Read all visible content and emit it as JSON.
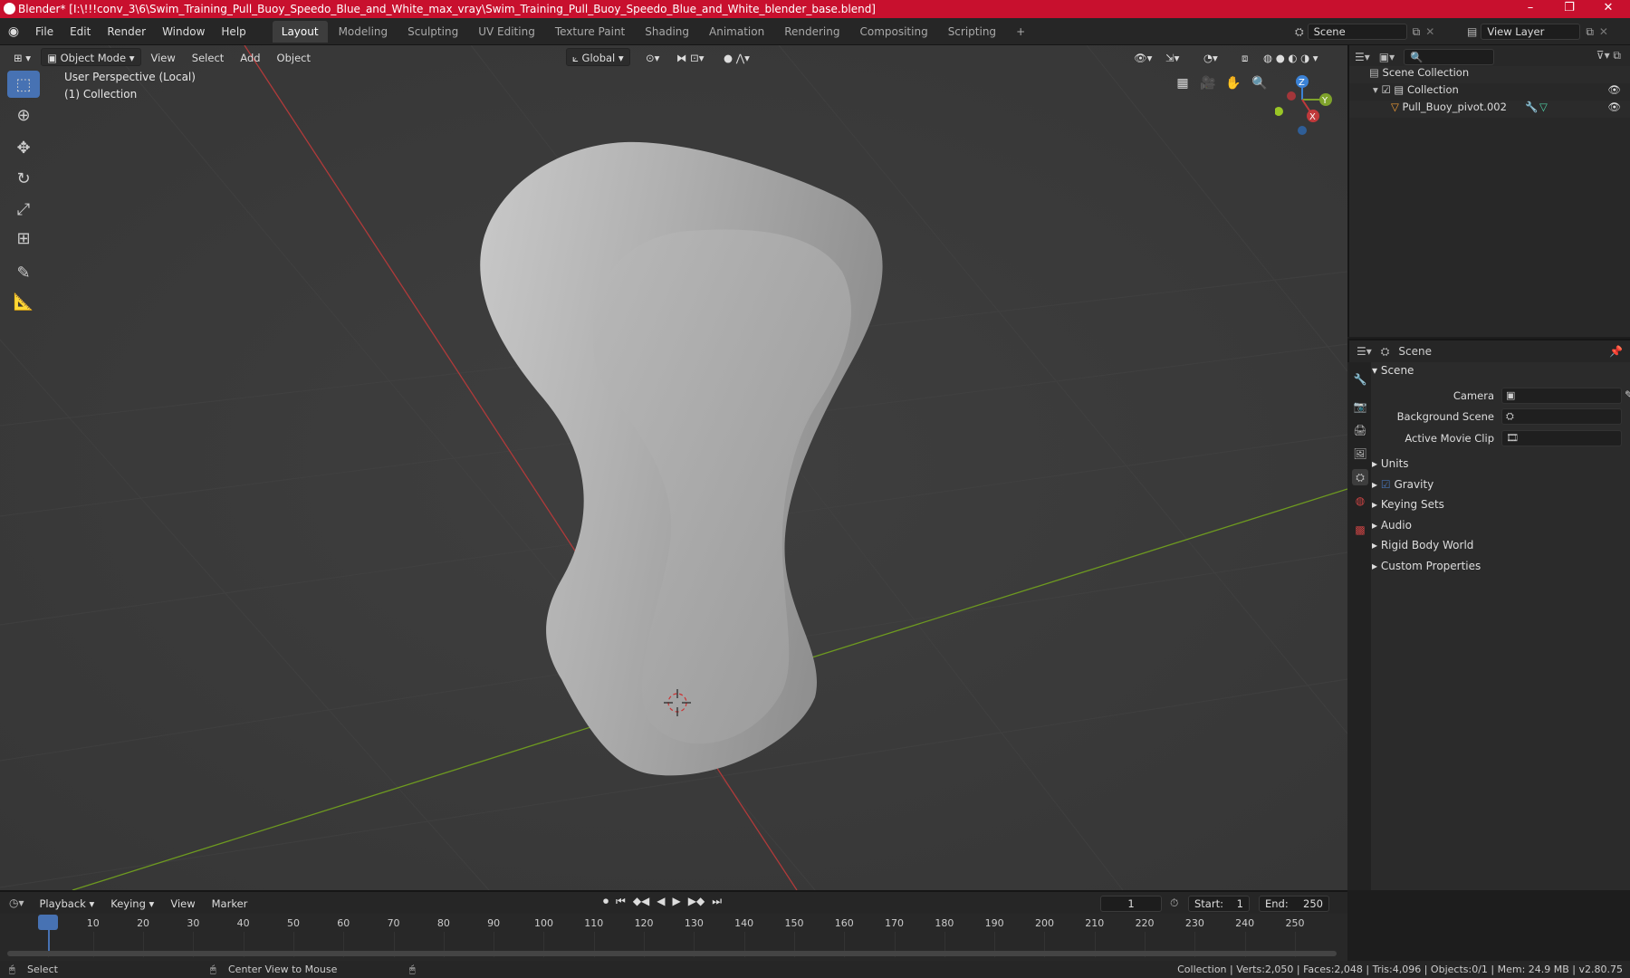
{
  "window": {
    "title": "Blender* [I:\\!!!conv_3\\6\\Swim_Training_Pull_Buoy_Speedo_Blue_and_White_max_vray\\Swim_Training_Pull_Buoy_Speedo_Blue_and_White_blender_base.blend]",
    "minimize": "–",
    "maximize": "❐",
    "close": "✕"
  },
  "menu": [
    "File",
    "Edit",
    "Render",
    "Window",
    "Help"
  ],
  "workspaces": [
    "Layout",
    "Modeling",
    "Sculpting",
    "UV Editing",
    "Texture Paint",
    "Shading",
    "Animation",
    "Rendering",
    "Compositing",
    "Scripting"
  ],
  "add_workspace": "+",
  "scene_field": "Scene",
  "view_layer_field": "View Layer",
  "viewport": {
    "mode": "Object Mode",
    "menus": [
      "View",
      "Select",
      "Add",
      "Object"
    ],
    "orientation": "Global",
    "overlay_text_1": "User Perspective (Local)",
    "overlay_text_2": "(1) Collection",
    "gizmo": {
      "x": "X",
      "y": "Y",
      "z": "Z"
    }
  },
  "outliner": {
    "search_placeholder": "",
    "rows": [
      "Scene Collection",
      "Collection",
      "Pull_Buoy_pivot.002"
    ]
  },
  "properties": {
    "header": "Scene",
    "section": "Scene",
    "fields": [
      "Camera",
      "Background Scene",
      "Active Movie Clip"
    ],
    "subsections": [
      "Units",
      "Gravity",
      "Keying Sets",
      "Audio",
      "Rigid Body World",
      "Custom Properties"
    ]
  },
  "timeline": {
    "menus": [
      "Playback",
      "Keying",
      "View",
      "Marker"
    ],
    "current_frame": "1",
    "start_label": "Start:",
    "start": "1",
    "end_label": "End:",
    "end": "250",
    "ticks": [
      "1",
      "10",
      "20",
      "30",
      "40",
      "50",
      "60",
      "70",
      "80",
      "90",
      "100",
      "110",
      "120",
      "130",
      "140",
      "150",
      "160",
      "170",
      "180",
      "190",
      "200",
      "210",
      "220",
      "230",
      "240",
      "250"
    ]
  },
  "status": {
    "left": "Select",
    "middle": "Center View to Mouse",
    "right": "Collection | Verts:2,050 | Faces:2,048 | Tris:4,096 | Objects:0/1 | Mem: 24.9 MB | v2.80.75"
  },
  "colors": {
    "accent": "#4772b3",
    "titlebar": "#c8102e",
    "x_axis": "#c0393b",
    "y_axis": "#7fa32b",
    "z_axis": "#3b82d6"
  }
}
